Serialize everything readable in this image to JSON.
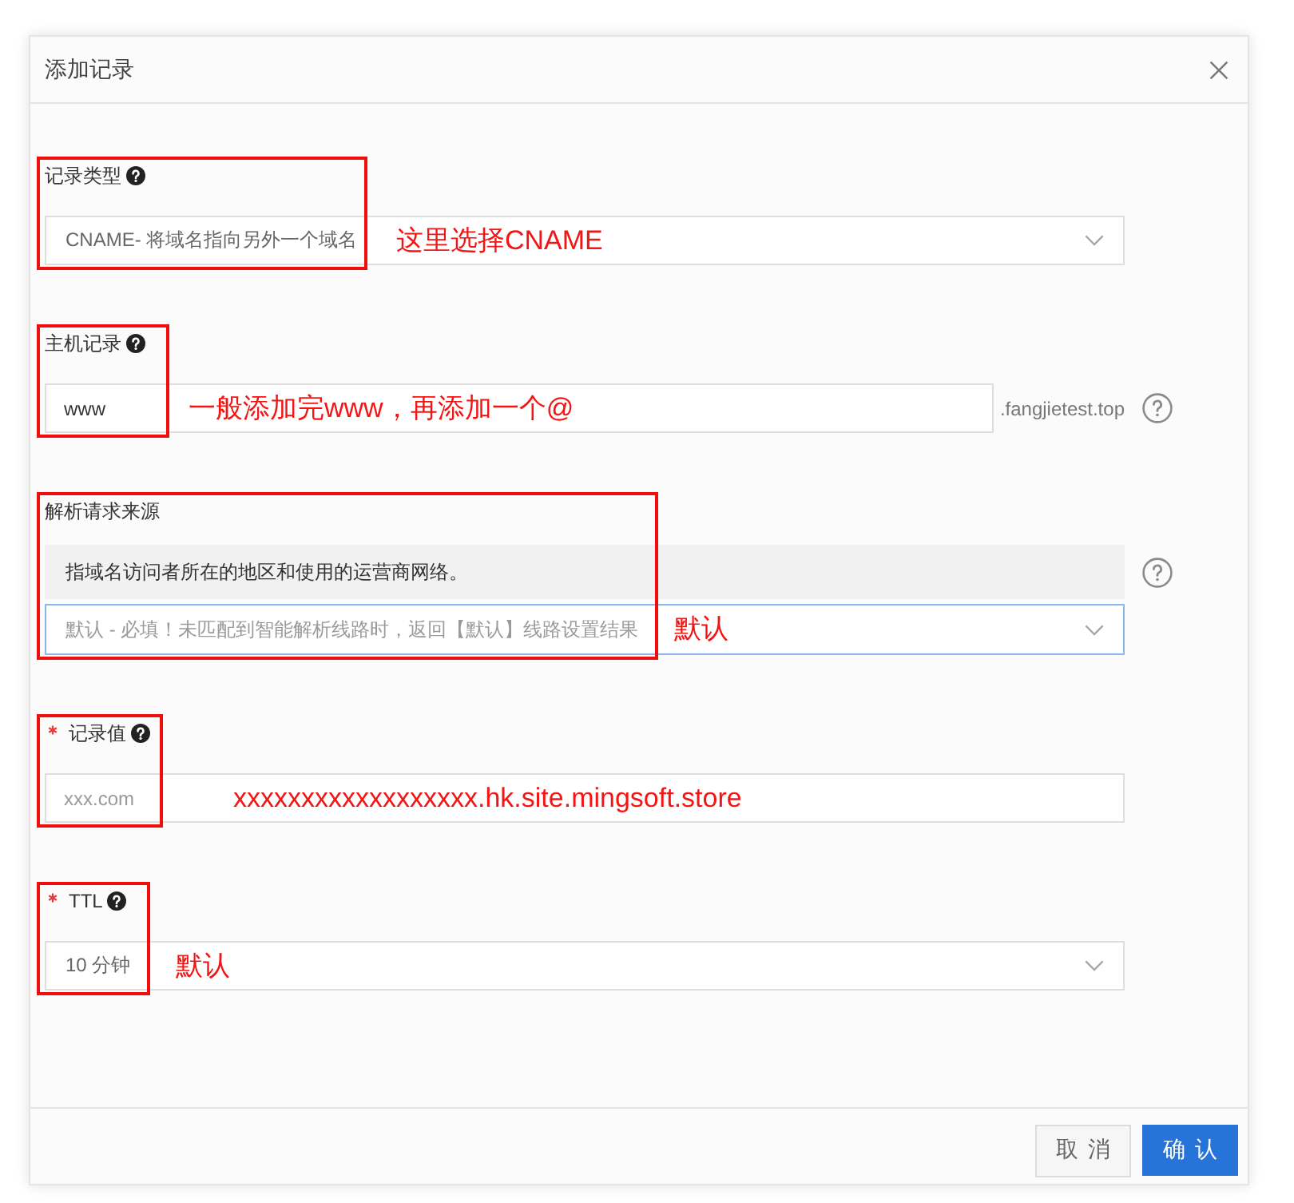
{
  "dialog": {
    "title": "添加记录"
  },
  "fields": [
    {
      "kind": "select",
      "label": "记录类型",
      "required": false,
      "label_help": true,
      "side_help": false,
      "focused": false,
      "value": "CNAME- 将域名指向另外一个域名",
      "annotation": "这里选择CNAME"
    },
    {
      "kind": "input",
      "label": "主机记录",
      "required": false,
      "label_help": true,
      "side_help": true,
      "focused": false,
      "value": "www",
      "suffix": ".fangjietest.top",
      "annotation": "一般添加完www，再添加一个@"
    },
    {
      "kind": "select",
      "label": "解析请求来源",
      "required": false,
      "label_help": false,
      "side_help": true,
      "focused": true,
      "note": "指域名访问者所在的地区和使用的运营商网络。",
      "placeholder": "默认 - 必填！未匹配到智能解析线路时，返回【默认】线路设置结果",
      "annotation": "默认"
    },
    {
      "kind": "input",
      "label": "记录值",
      "required": true,
      "label_help": true,
      "side_help": false,
      "focused": false,
      "placeholder": "xxx.com",
      "annotation": "xxxxxxxxxxxxxxxxxx.hk.site.mingsoft.store"
    },
    {
      "kind": "select",
      "label": "TTL",
      "required": true,
      "label_help": true,
      "side_help": false,
      "focused": false,
      "value": "10 分钟",
      "annotation": "默认"
    }
  ],
  "buttons": [
    {
      "kind": "secondary",
      "label": "取消"
    },
    {
      "kind": "primary",
      "label": "确认"
    }
  ]
}
